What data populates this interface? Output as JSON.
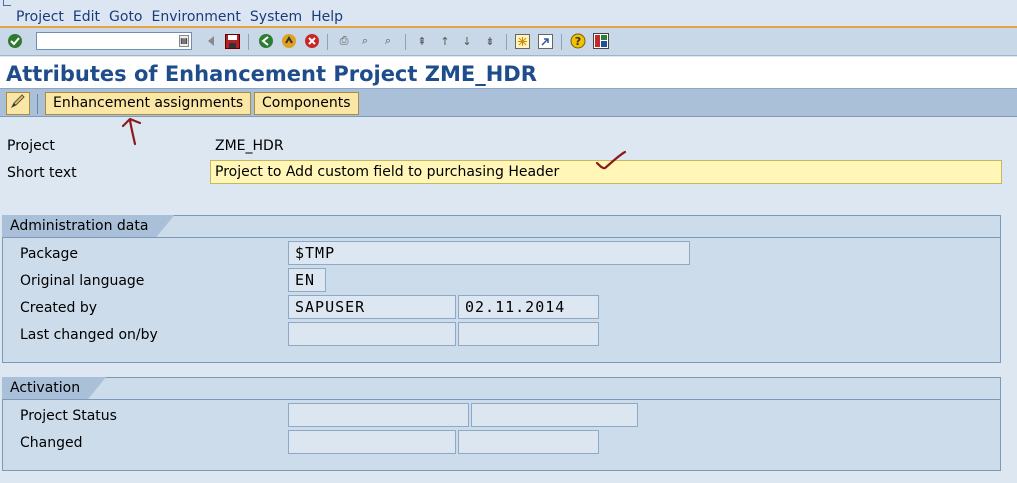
{
  "menu": {
    "items": [
      "Project",
      "Edit",
      "Goto",
      "Environment",
      "System",
      "Help"
    ]
  },
  "toolbar": {
    "command_value": "",
    "icons": [
      "check-icon",
      "back-arrow-icon",
      "save-icon",
      "back-icon",
      "exit-icon",
      "cancel-icon",
      "print-icon",
      "find-icon",
      "find-next-icon",
      "first-page-icon",
      "prev-page-icon",
      "next-page-icon",
      "last-page-icon",
      "new-session-icon",
      "shortcut-icon",
      "help-icon",
      "layout-icon"
    ]
  },
  "title": "Attributes of Enhancement Project ZME_HDR",
  "app_toolbar": {
    "enhancement_assignments": "Enhancement assignments",
    "components": "Components"
  },
  "header": {
    "project_label": "Project",
    "project_value": "ZME_HDR",
    "short_text_label": "Short text",
    "short_text_value": "Project to Add custom field to purchasing Header"
  },
  "admin": {
    "title": "Administration data",
    "package_label": "Package",
    "package_value": "$TMP",
    "orig_lang_label": "Original language",
    "orig_lang_value": "EN",
    "created_by_label": "Created by",
    "created_by_user": "SAPUSER",
    "created_by_date": "02.11.2014",
    "last_changed_label": "Last changed on/by",
    "last_changed_user": "",
    "last_changed_date": ""
  },
  "activation": {
    "title": "Activation",
    "status_label": "Project Status",
    "status_value_1": "",
    "status_value_2": "",
    "changed_label": "Changed",
    "changed_value_1": "",
    "changed_value_2": ""
  },
  "colors": {
    "accent_orange": "#e8a33c",
    "title_blue": "#1f4c8a",
    "button_yellow": "#fbe7a5",
    "annotation_red": "#8b1a1a"
  }
}
